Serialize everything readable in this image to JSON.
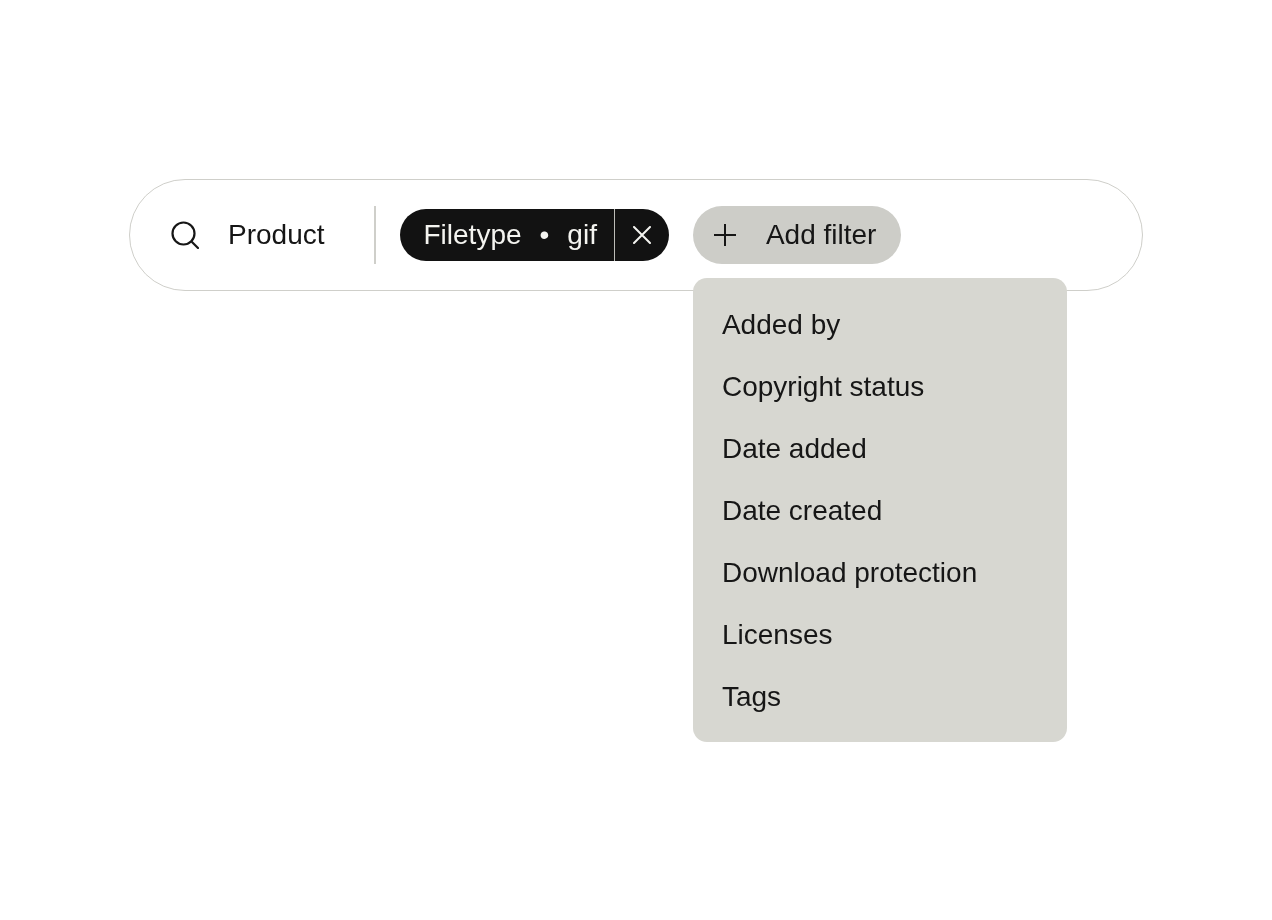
{
  "search": {
    "value": "Product"
  },
  "filters": [
    {
      "field": "Filetype",
      "separator": "•",
      "value": "gif"
    }
  ],
  "add_filter": {
    "label": "Add filter",
    "expanded": true
  },
  "menu": {
    "items": [
      "Added by",
      "Copyright status",
      "Date added",
      "Date created",
      "Download protection",
      "Licenses",
      "Tags"
    ]
  }
}
